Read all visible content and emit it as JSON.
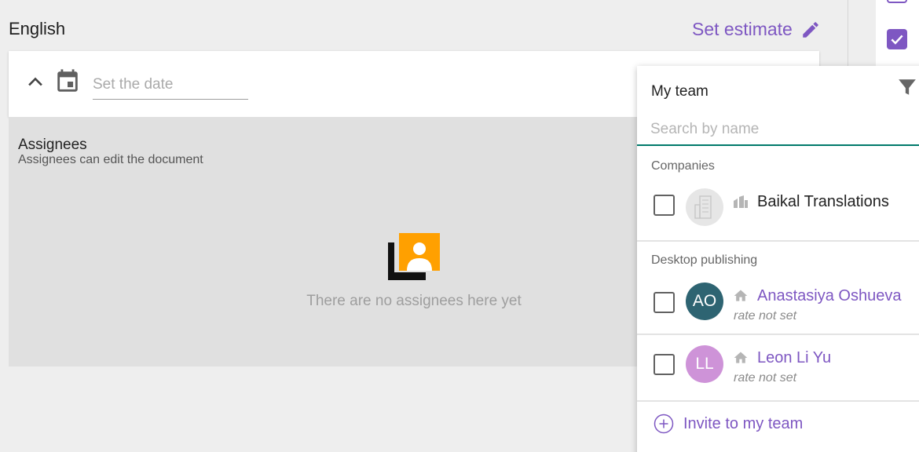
{
  "document": {
    "language": "English",
    "set_estimate_label": "Set estimate"
  },
  "date": {
    "placeholder": "Set the date",
    "value": ""
  },
  "assignees": {
    "title": "Assignees",
    "subtitle": "Assignees can edit the document",
    "empty_text": "There are no assignees here yet"
  },
  "team": {
    "title": "My team",
    "search_placeholder": "Search by name",
    "sections": [
      {
        "label": "Companies",
        "items": [
          {
            "name": "Baikal Translations",
            "checked": false
          }
        ]
      },
      {
        "label": "Desktop publishing",
        "items": [
          {
            "initials": "AO",
            "name": "Anastasiya Oshueva",
            "rate": "rate not set",
            "checked": false,
            "avatar_color": "#2e6472"
          },
          {
            "initials": "LL",
            "name": "Leon Li Yu",
            "rate": "rate not set",
            "checked": false,
            "avatar_color": "#ce93d8"
          }
        ]
      }
    ],
    "invite_label": "Invite to my team"
  },
  "colors": {
    "accent": "#7e57c2",
    "search_underline": "#00796b",
    "empty_illustration_orange": "#ffa000"
  },
  "icons": {
    "estimate": "pencil-icon",
    "collapse": "chevron-up-icon",
    "date": "calendar-icon",
    "filter": "filter-icon",
    "company": "building-icon",
    "member_type": "home-icon",
    "invite": "plus-circle-icon"
  }
}
